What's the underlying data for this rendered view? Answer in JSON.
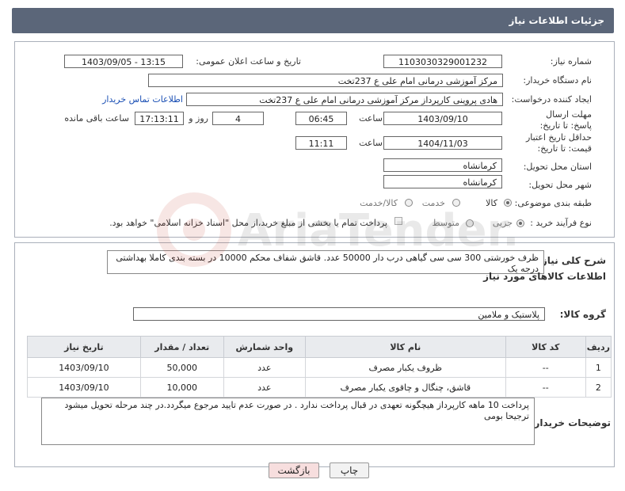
{
  "header": {
    "title": "جزئیات اطلاعات نیاز"
  },
  "form": {
    "need_number_label": "شماره نیاز:",
    "need_number": "1103030329001232",
    "announce_label": "تاریخ و ساعت اعلان عمومی:",
    "announce_value": "1403/09/05 - 13:15",
    "buyer_org_label": "نام دستگاه خریدار:",
    "buyer_org": "مرکز آموزشی درمانی امام علی ع 237تخت",
    "requester_label": "ایجاد کننده درخواست:",
    "requester": "هادی پروینی کارپرداز  مرکز آموزشی درمانی امام علی ع 237تخت",
    "contact_link": "اطلاعات تماس خریدار",
    "send_deadline_label": "مهلت ارسال پاسخ: تا تاریخ:",
    "send_deadline_date": "1403/09/10",
    "time_label": "ساعت",
    "send_deadline_time": "06:45",
    "days_value": "4",
    "days_label": "روز و",
    "remaining_time": "17:13:11",
    "remaining_label": "ساعت باقی مانده",
    "price_validity_label": "حداقل تاریخ اعتبار قیمت: تا تاریخ:",
    "price_validity_date": "1404/11/03",
    "price_validity_time": "11:11",
    "province_label": "استان محل تحویل:",
    "province": "کرمانشاه",
    "city_label": "شهر محل تحویل:",
    "city": "کرمانشاه",
    "category_label": "طبقه بندی موضوعی:",
    "category_options": [
      "کالا",
      "خدمت",
      "کالا/خدمت"
    ],
    "category_selected": "کالا",
    "process_label": "نوع فرآیند خرید :",
    "process_options": [
      "جزیی",
      "متوسط"
    ],
    "process_selected": "جزیی",
    "payment_note": "پرداخت تمام یا بخشی از مبلغ خرید،از محل \"اسناد خزانه اسلامی\" خواهد بود."
  },
  "description": {
    "label": "شرح کلی نیاز:",
    "text": "ظرف خورشتی  300 سی سی گیاهی درب دار 50000 عدد.  قاشق شفاف محکم  10000 در بسته بندی کاملا بهداشتی  درجه یک"
  },
  "goods": {
    "section_title": "اطلاعات کالاهای مورد نیاز",
    "group_label": "گروه کالا:",
    "group_value": "پلاستیک و ملامین",
    "columns": [
      "ردیف",
      "کد کالا",
      "نام کالا",
      "واحد شمارش",
      "تعداد / مقدار",
      "تاریخ نیاز"
    ],
    "rows": [
      {
        "row": "1",
        "code": "--",
        "name": "ظروف یکبار مصرف",
        "unit": "عدد",
        "qty": "50,000",
        "date": "1403/09/10"
      },
      {
        "row": "2",
        "code": "--",
        "name": "قاشق، چنگال و چاقوی یکبار مصرف",
        "unit": "عدد",
        "qty": "10,000",
        "date": "1403/09/10"
      }
    ]
  },
  "buyer_notes": {
    "label": "توضیحات خریدار:",
    "text": "پرداخت 10 ماهه کارپرداز هیچگونه تعهدی در قبال پرداخت ندارد . در صورت عدم تایید مرجوع میگردد.در چند مرحله تحویل میشود ترجیحا بومی"
  },
  "buttons": {
    "print": "چاپ",
    "back": "بازگشت"
  },
  "watermark": {
    "text": "AriaTender.net",
    "icon": "aria-logo-icon"
  },
  "colors": {
    "header_bg": "#5b6679",
    "link": "#1a4fb4",
    "back_btn": "#f7dede",
    "print_btn": "#f2f2f2"
  }
}
